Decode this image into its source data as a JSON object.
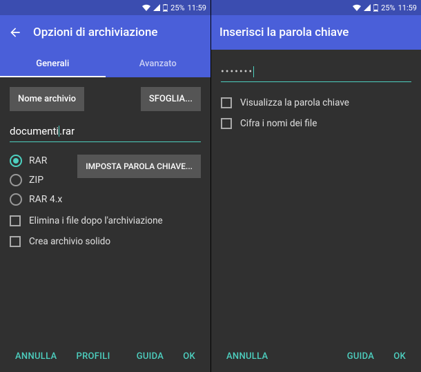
{
  "statusbar": {
    "battery": "25%",
    "time": "11:59"
  },
  "left": {
    "title": "Opzioni di archiviazione",
    "tabs": {
      "general": "Generali",
      "advanced": "Avanzato"
    },
    "archiveNameBtn": "Nome archivio",
    "browseBtn": "SFOGLIA...",
    "filename": "documenti.rar",
    "formats": {
      "rar": "RAR",
      "zip": "ZIP",
      "rar4": "RAR 4.x"
    },
    "setPasswordBtn": "IMPOSTA PAROLA CHIAVE...",
    "deleteAfter": "Elimina i file dopo l'archiviazione",
    "solidArchive": "Crea archivio solido",
    "actions": {
      "cancel": "ANNULLA",
      "profiles": "PROFILI",
      "help": "GUIDA",
      "ok": "OK"
    }
  },
  "right": {
    "title": "Inserisci la parola chiave",
    "passwordMasked": "•••••••",
    "showPassword": "Visualizza la parola chiave",
    "encryptNames": "Cifra i nomi dei file",
    "actions": {
      "cancel": "ANNULLA",
      "help": "GUIDA",
      "ok": "OK"
    }
  }
}
